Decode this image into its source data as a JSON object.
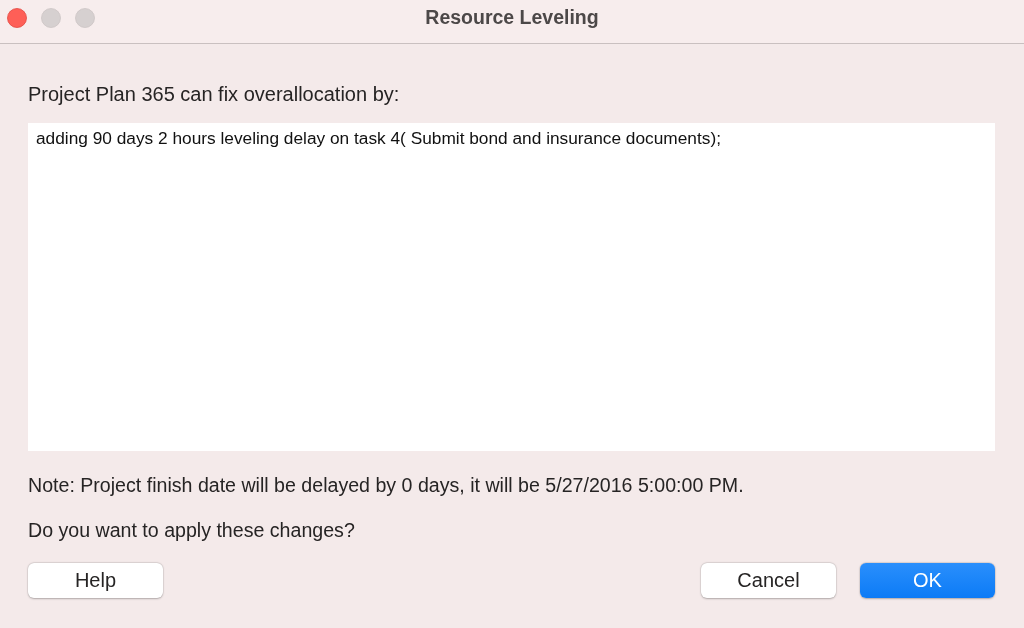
{
  "window": {
    "title": "Resource Leveling",
    "controls": [
      {
        "kind": "close",
        "disabled": false
      },
      {
        "kind": "minimize",
        "disabled": true
      },
      {
        "kind": "zoom",
        "disabled": true
      }
    ]
  },
  "intro": "Project Plan 365 can fix overallocation by:",
  "suggestions": [
    "adding 90 days 2 hours leveling delay on task 4( Submit bond and insurance documents);"
  ],
  "note": "Note: Project finish date will be delayed by 0 days, it will be 5/27/2016 5:00:00 PM.",
  "question": "Do you want to apply these changes?",
  "left_buttons": [
    {
      "label": "Help",
      "default": false
    }
  ],
  "right_buttons": [
    {
      "label": "Cancel",
      "default": false
    },
    {
      "label": "OK",
      "default": true
    }
  ]
}
